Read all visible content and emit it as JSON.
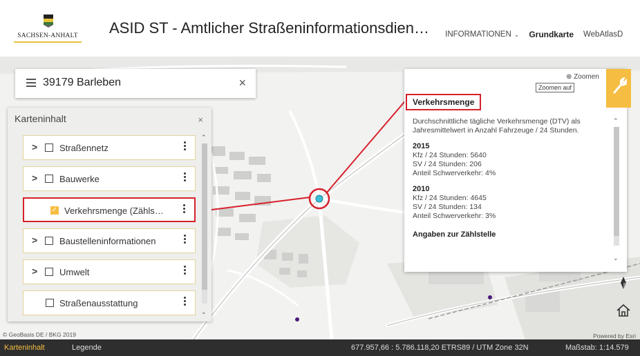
{
  "header": {
    "logo_text": "SACHSEN-ANHALT",
    "title": "ASID ST - Amtlicher Straßeninformationsdien…",
    "nav": {
      "informationen": "INFORMATIONEN",
      "grundkarte": "Grundkarte",
      "webatlas": "WebAtlasD"
    }
  },
  "search": {
    "query": "39179 Barleben",
    "clear": "×"
  },
  "panel": {
    "title": "Karteninhalt",
    "close": "×",
    "layers": [
      {
        "label": "Straßennetz",
        "checked": false,
        "expandable": true
      },
      {
        "label": "Bauwerke",
        "checked": false,
        "expandable": true
      },
      {
        "label": "Verkehrsmenge (Zähls…",
        "checked": true,
        "expandable": false
      },
      {
        "label": "Baustelleninformationen",
        "checked": false,
        "expandable": true
      },
      {
        "label": "Umwelt",
        "checked": false,
        "expandable": true
      },
      {
        "label": "Straßenausstattung",
        "checked": false,
        "expandable": false
      }
    ]
  },
  "popup": {
    "zoom_label": "Zoomen",
    "zoom_tooltip": "Zoomen auf",
    "close": "×",
    "title": "Verkehrsmenge",
    "description": "Durchschnittliche tägliche Verkehrsmenge (DTV) als Jahresmittelwert in Anzahl Fahrzeuge / 24 Stunden.",
    "years": [
      {
        "year": "2015",
        "kfz": "Kfz / 24 Stunden: 5640",
        "sv": "SV / 24 Stunden: 206",
        "anteil": "Anteil Schwerverkehr: 4%"
      },
      {
        "year": "2010",
        "kfz": "Kfz / 24 Stunden: 4645",
        "sv": "SV / 24 Stunden: 134",
        "anteil": "Anteil Schwerverkehr: 3%"
      }
    ],
    "section": "Angaben zur Zählstelle"
  },
  "attribution_left": "© GeoBasis DE / BKG 2019",
  "attribution_right": "Powered by Esri",
  "statusbar": {
    "tab_karteninhalt": "Karteninhalt",
    "tab_legende": "Legende",
    "coords": "677.957,66 : 5.786.118,20  ETRS89 / UTM Zone 32N",
    "scale": "Maßstab: 1:14.579"
  },
  "colors": {
    "accent": "#f5bd41",
    "highlight": "#d6202b",
    "statusbar": "#2e2e2e"
  },
  "icons": [
    "menu-icon",
    "close-icon",
    "chevron-right-icon",
    "checkbox-icon",
    "more-vertical-icon",
    "zoom-icon",
    "wrench-icon",
    "compass-icon",
    "home-icon"
  ]
}
